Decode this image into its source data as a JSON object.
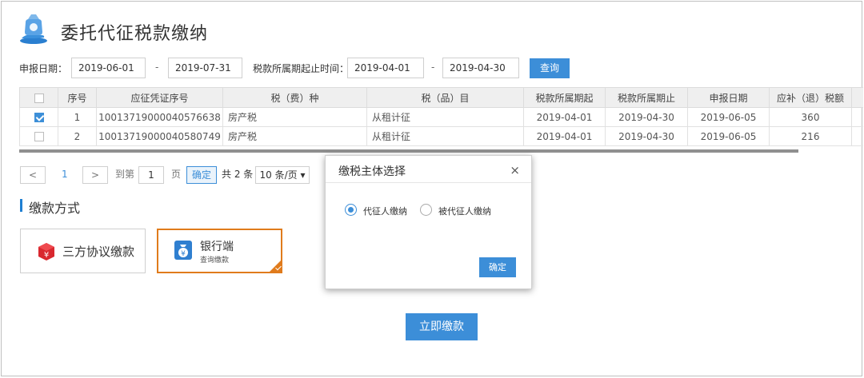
{
  "page": {
    "title": "委托代征税款缴纳"
  },
  "filters": {
    "declare_date_label": "申报日期：",
    "declare_start": "2019-06-01",
    "declare_end": "2019-07-31",
    "period_label": "税款所属期起止时间：",
    "period_start": "2019-04-01",
    "period_end": "2019-04-30",
    "separator": "-",
    "query_button": "查询"
  },
  "table": {
    "columns": [
      "序号",
      "应征凭证序号",
      "税（费）种",
      "税（品）目",
      "税款所属期起",
      "税款所属期止",
      "申报日期",
      "应补（退）税额"
    ],
    "rows": [
      {
        "checked": true,
        "cells": [
          "1",
          "10013719000040576638",
          "房产税",
          "从租计征",
          "2019-04-01",
          "2019-04-30",
          "2019-06-05",
          "360"
        ]
      },
      {
        "checked": false,
        "cells": [
          "2",
          "10013719000040580749",
          "房产税",
          "从租计征",
          "2019-04-01",
          "2019-04-30",
          "2019-06-05",
          "216"
        ]
      }
    ]
  },
  "pager": {
    "prev": "<",
    "current": "1",
    "next": ">",
    "goto_label": "到第",
    "page_input": "1",
    "page_unit": "页",
    "confirm": "确定",
    "total": "共 2 条",
    "page_size": "10 条/页 ▾"
  },
  "payment": {
    "section_title": "缴款方式",
    "option1_label": "三方协议缴款",
    "option2_label": "银行端",
    "option2_sub": "查询缴款",
    "pay_now": "立即缴款"
  },
  "modal": {
    "title": "缴税主体选择",
    "close": "×",
    "option1": "代征人缴纳",
    "option2": "被代征人缴纳",
    "ok": "确定"
  },
  "colors": {
    "accent": "#3c8ed8",
    "selected_border": "#e07b1c",
    "icon_red": "#d9282f"
  }
}
